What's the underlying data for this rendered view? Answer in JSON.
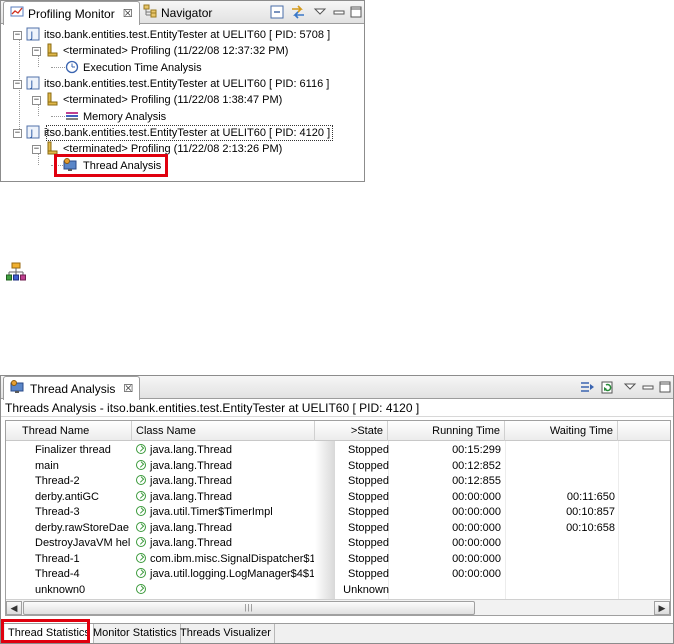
{
  "profiling_monitor": {
    "tabs": [
      {
        "label": "Profiling Monitor",
        "icon": "profiling-monitor-icon",
        "active": true,
        "close": "☒"
      },
      {
        "label": "Navigator",
        "icon": "navigator-icon",
        "active": false
      }
    ],
    "toolbar_icons": [
      "collapse-all-icon",
      "link-with-editor-icon",
      "view-menu-icon",
      "minimize-icon",
      "maximize-icon"
    ],
    "tree": [
      {
        "level": 0,
        "expander": "−",
        "icon": "java-process-icon",
        "label": "itso.bank.entities.test.EntityTester at UELIT60 [ PID: 5708 ]"
      },
      {
        "level": 1,
        "expander": "−",
        "icon": "agent-icon",
        "label": "<terminated> Profiling (11/22/08 12:37:32 PM)"
      },
      {
        "level": 2,
        "icon": "execution-time-icon",
        "label": "Execution Time Analysis"
      },
      {
        "level": 0,
        "expander": "−",
        "icon": "java-process-icon",
        "label": "itso.bank.entities.test.EntityTester at UELIT60 [ PID: 6116 ]"
      },
      {
        "level": 1,
        "expander": "−",
        "icon": "agent-icon",
        "label": "<terminated> Profiling (11/22/08 1:38:47 PM)"
      },
      {
        "level": 2,
        "icon": "memory-analysis-icon",
        "label": "Memory Analysis"
      },
      {
        "level": 0,
        "expander": "−",
        "icon": "java-process-icon",
        "label": "itso.bank.entities.test.EntityTester at UELIT60 [ PID: 4120 ]"
      },
      {
        "level": 1,
        "expander": "−",
        "icon": "agent-icon",
        "label": "<terminated> Profiling (11/22/08 2:13:26 PM)"
      },
      {
        "level": 2,
        "icon": "thread-analysis-icon",
        "label": "Thread Analysis"
      }
    ]
  },
  "floating_icon": "threads-visualizer-hierarchy-icon",
  "thread_analysis": {
    "tab_label": "Thread Analysis",
    "tab_close": "☒",
    "subtitle": "Threads Analysis - itso.bank.entities.test.EntityTester at UELIT60 [ PID: 4120 ]",
    "columns": [
      "Thread Name",
      "Class Name",
      ">State",
      "Running Time",
      "Waiting Time"
    ],
    "rows": [
      {
        "thread": "Finalizer thread",
        "class": "java.lang.Thread",
        "state": "Stopped",
        "running": "00:15:299",
        "waiting": ""
      },
      {
        "thread": "main",
        "class": "java.lang.Thread",
        "state": "Stopped",
        "running": "00:12:852",
        "waiting": ""
      },
      {
        "thread": "Thread-2",
        "class": "java.lang.Thread",
        "state": "Stopped",
        "running": "00:12:855",
        "waiting": ""
      },
      {
        "thread": "derby.antiGC",
        "class": "java.lang.Thread",
        "state": "Stopped",
        "running": "00:00:000",
        "waiting": "00:11:650"
      },
      {
        "thread": "Thread-3",
        "class": "java.util.Timer$TimerImpl",
        "state": "Stopped",
        "running": "00:00:000",
        "waiting": "00:10:857"
      },
      {
        "thread": "derby.rawStoreDae",
        "class": "java.lang.Thread",
        "state": "Stopped",
        "running": "00:00:000",
        "waiting": "00:10:658"
      },
      {
        "thread": "DestroyJavaVM help",
        "class": "java.lang.Thread",
        "state": "Stopped",
        "running": "00:00:000",
        "waiting": ""
      },
      {
        "thread": "Thread-1",
        "class": "com.ibm.misc.SignalDispatcher$1",
        "state": "Stopped",
        "running": "00:00:000",
        "waiting": ""
      },
      {
        "thread": "Thread-4",
        "class": "java.util.logging.LogManager$4$1",
        "state": "Stopped",
        "running": "00:00:000",
        "waiting": ""
      },
      {
        "thread": "unknown0",
        "class": "",
        "state": "Unknown",
        "running": "",
        "waiting": ""
      }
    ],
    "scroll_left": "◀",
    "scroll_right": "▶",
    "scroll_grip": "|||",
    "bottom_tabs": [
      {
        "label": "Thread Statistics",
        "active": true
      },
      {
        "label": "Monitor Statistics",
        "active": false
      },
      {
        "label": "Threads Visualizer",
        "active": false
      }
    ]
  }
}
